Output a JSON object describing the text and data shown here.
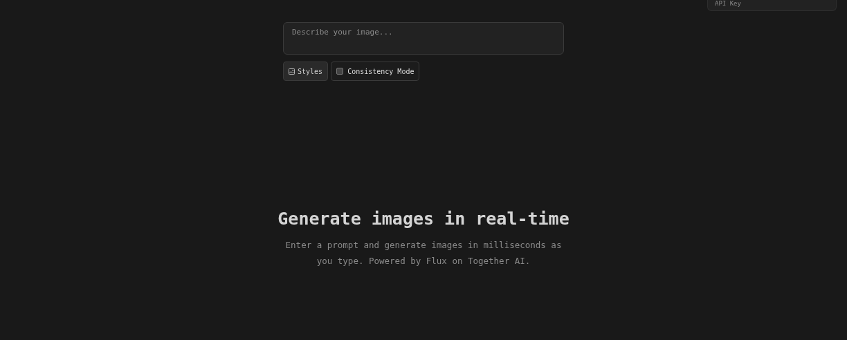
{
  "api_key_panel": {
    "label": "API Key"
  },
  "prompt": {
    "placeholder": "Describe your image..."
  },
  "styles_button": {
    "label": "Styles"
  },
  "consistency_mode": {
    "label": "Consistency Mode",
    "checked": false
  },
  "hero": {
    "title": "Generate images in real-time",
    "subtitle": "Enter a prompt and generate images in milliseconds as you type. Powered by Flux on Together AI."
  }
}
